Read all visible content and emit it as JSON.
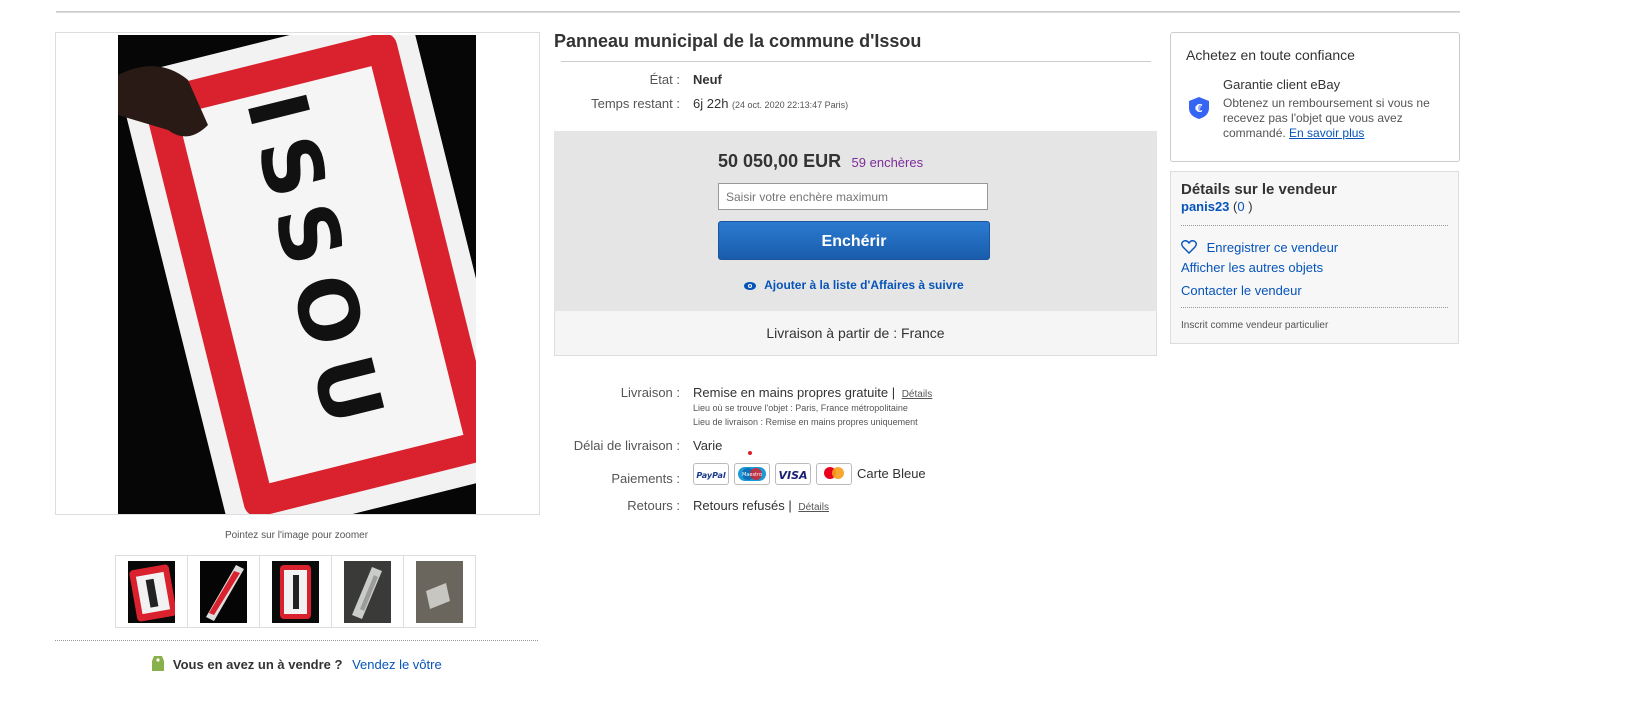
{
  "gallery": {
    "zoom_hint": "Pointez sur l'image pour zoomer",
    "main_image_text": "ISSOU",
    "sell_prompt": "Vous en avez un à vendre ?",
    "sell_link": "Vendez le vôtre"
  },
  "listing": {
    "title": "Panneau municipal de la commune d'Issou",
    "condition_label": "État :",
    "condition_value": "Neuf",
    "time_label": "Temps restant :",
    "time_value": "6j 22h",
    "time_detail": "(24 oct. 2020   22:13:47 Paris)"
  },
  "bid": {
    "price": "50 050,00 EUR",
    "bid_count": "59 enchères",
    "input_placeholder": "Saisir votre enchère maximum",
    "button_label": "Enchérir",
    "watch_label": "Ajouter à la liste d'Affaires à suivre",
    "ships_from": "Livraison à partir de : France"
  },
  "details": {
    "shipping_label": "Livraison :",
    "shipping_value": "Remise en mains propres gratuite |",
    "shipping_link": "Détails",
    "item_location": "Lieu où se trouve l'objet :  Paris, France métropolitaine",
    "delivery_place": "Lieu de livraison :  Remise en mains propres uniquement",
    "delay_label": "Délai de livraison :",
    "delay_value": "Varie",
    "payments_label": "Paiements :",
    "payment_methods": [
      "PayPal",
      "Maestro",
      "VISA",
      "Mastercard"
    ],
    "payments_extra": "Carte Bleue",
    "returns_label": "Retours :",
    "returns_value": "Retours refusés |",
    "returns_link": "Détails"
  },
  "trust": {
    "title": "Achetez en toute confiance",
    "guarantee_title": "Garantie client eBay",
    "guarantee_text": "Obtenez un remboursement si vous ne recevez pas l'objet que vous avez commandé.",
    "learn_more": "En savoir plus",
    "icon": "shield-euro-icon"
  },
  "seller": {
    "title": "Détails sur le vendeur",
    "name": "panis23",
    "feedback_open": "(",
    "feedback_score": "0",
    "feedback_close": ")",
    "save_seller": "Enregistrer ce vendeur",
    "other_items": "Afficher les autres objets",
    "contact": "Contacter le vendeur",
    "account_type": "Inscrit comme vendeur particulier"
  },
  "colors": {
    "link": "#0654ba",
    "bid_count": "#7b2d9b",
    "button": "#1a5cab",
    "sign_red": "#d9222e"
  }
}
